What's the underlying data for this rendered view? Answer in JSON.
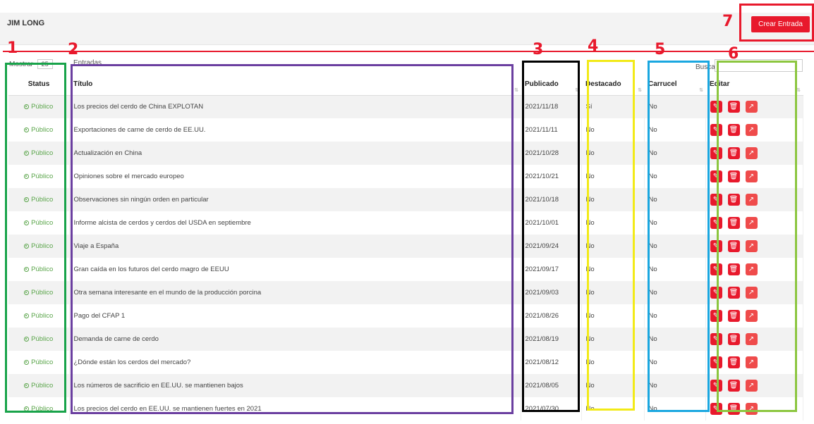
{
  "header": {
    "user_name": "JIM LONG",
    "create_button": "Crear Entrada"
  },
  "controls": {
    "show_label": "Mostrar",
    "page_size": "25",
    "entries_label": "Entradas",
    "search_label": "Buscar:",
    "search_value": ""
  },
  "columns": {
    "status": "Status",
    "title": "Título",
    "published": "Publicado",
    "featured": "Destacado",
    "carousel": "Carrucel",
    "edit": "Editar"
  },
  "status_icon": "circle-dot-icon",
  "action_icons": [
    "edit-icon",
    "trash-icon",
    "external-edit-icon"
  ],
  "accent_color": "#e8192c",
  "status_color": "#5aa54a",
  "annotations": [
    "1",
    "2",
    "3",
    "4",
    "5",
    "6",
    "7"
  ],
  "rows": [
    {
      "status": "Público",
      "title": "Los precios del cerdo de China EXPLOTAN",
      "published": "2021/11/18",
      "featured": "Sí",
      "carousel": "No"
    },
    {
      "status": "Público",
      "title": "Exportaciones de carne de cerdo de EE.UU.",
      "published": "2021/11/11",
      "featured": "No",
      "carousel": "No"
    },
    {
      "status": "Público",
      "title": "Actualización en China",
      "published": "2021/10/28",
      "featured": "No",
      "carousel": "No"
    },
    {
      "status": "Público",
      "title": "Opiniones sobre el mercado europeo",
      "published": "2021/10/21",
      "featured": "No",
      "carousel": "No"
    },
    {
      "status": "Público",
      "title": "Observaciones sin ningún orden en particular",
      "published": "2021/10/18",
      "featured": "No",
      "carousel": "No"
    },
    {
      "status": "Público",
      "title": "Informe alcista de cerdos y cerdos del USDA en septiembre",
      "published": "2021/10/01",
      "featured": "No",
      "carousel": "No"
    },
    {
      "status": "Público",
      "title": "Viaje a España",
      "published": "2021/09/24",
      "featured": "No",
      "carousel": "No"
    },
    {
      "status": "Público",
      "title": "Gran caída en los futuros del cerdo magro de EEUU",
      "published": "2021/09/17",
      "featured": "No",
      "carousel": "No"
    },
    {
      "status": "Público",
      "title": "Otra semana interesante en el mundo de la producción porcina",
      "published": "2021/09/03",
      "featured": "No",
      "carousel": "No"
    },
    {
      "status": "Público",
      "title": "Pago del CFAP 1",
      "published": "2021/08/26",
      "featured": "No",
      "carousel": "No"
    },
    {
      "status": "Público",
      "title": "Demanda de carne de cerdo",
      "published": "2021/08/19",
      "featured": "No",
      "carousel": "No"
    },
    {
      "status": "Público",
      "title": "¿Dónde están los cerdos del mercado?",
      "published": "2021/08/12",
      "featured": "No",
      "carousel": "No"
    },
    {
      "status": "Público",
      "title": "Los números de sacrificio en EE.UU. se mantienen bajos",
      "published": "2021/08/05",
      "featured": "No",
      "carousel": "No"
    },
    {
      "status": "Público",
      "title": "Los precios del cerdo en EE.UU. se mantienen fuertes en 2021",
      "published": "2021/07/30",
      "featured": "No",
      "carousel": "No"
    }
  ]
}
